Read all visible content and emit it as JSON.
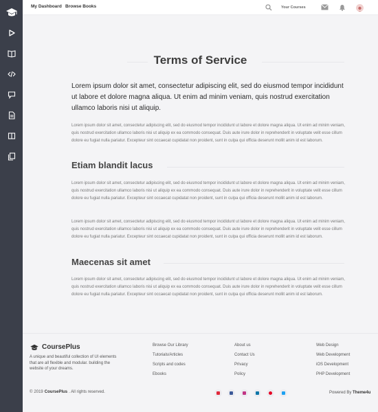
{
  "header": {
    "nav": [
      "My Dashboard",
      "Browse Books"
    ],
    "your_courses": "Your Courses"
  },
  "sidebar": {
    "icons": [
      "graduation-cap-icon",
      "play-icon",
      "book-icon",
      "code-icon",
      "comment-icon",
      "document-icon",
      "columns-icon",
      "copy-icon"
    ]
  },
  "main": {
    "title": "Terms of Service",
    "lead": "Lorem ipsum dolor sit amet, consectetur adipiscing elit, sed do eiusmod tempor incididunt ut labore et dolore magna aliqua. Ut enim ad minim veniam, quis nostrud exercitation ullamco laboris nisi ut aliquip.",
    "paragraph": "Lorem ipsum dolor sit amet, consectetur adipiscing elit, sed do eiusmod tempor incididunt ut labore et dolore magna aliqua. Ut enim ad minim veniam, quis nostrud exercitation ullamco laboris nisi ut aliquip ex ea commodo consequat. Duis aute irure dolor in reprehenderit in voluptate velit esse cillum dolore eu fugiat nulla pariatur. Excepteur sint occaecat cupidatat non proident, sunt in culpa qui officia deserunt mollit anim id est laborum.",
    "section1_title": "Etiam blandit lacus",
    "section2_title": "Maecenas sit amet"
  },
  "footer": {
    "brand": "CoursePlus",
    "description": "A unique and beautiful collection of UI elements that are all flexible and modular. building the website of your dreams.",
    "col1": [
      "Browse Our Library",
      "Tutorials/Articles",
      "Scripts and codes",
      "Ebooks"
    ],
    "col2": [
      "About us",
      "Contact Us",
      "Privacy",
      "Policy"
    ],
    "col3": [
      "Web Design",
      "Web Development",
      "iOS Development",
      "PHP Development"
    ],
    "copyright_year": "2019",
    "copyright_brand": "CoursePlus",
    "copyright_rest": ". All rights reserved.",
    "powered_prefix": "Powered By",
    "powered_brand": "Theme4u",
    "socials": [
      "youtube-icon",
      "facebook-icon",
      "instagram-icon",
      "linkedin-icon",
      "pinterest-icon",
      "twitter-icon"
    ],
    "social_colors": [
      "#e0293b",
      "#3b5998",
      "#c13584",
      "#0e76a8",
      "#e60023",
      "#1da1f2"
    ]
  }
}
